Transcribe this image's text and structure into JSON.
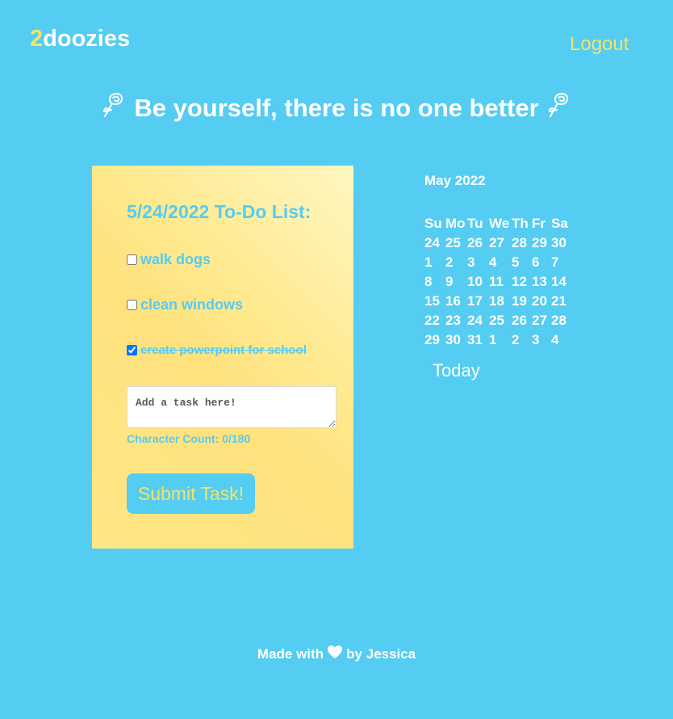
{
  "header": {
    "logo_accent": "2",
    "logo_text": "doozies",
    "logout_label": "Logout"
  },
  "quote": {
    "text": "Be yourself, there is no one better",
    "icon": "rose-icon"
  },
  "todo": {
    "title": "5/24/2022 To-Do List:",
    "tasks": [
      {
        "label": "walk dogs",
        "done": false
      },
      {
        "label": "clean windows",
        "done": false
      },
      {
        "label": "create powerpoint for school",
        "done": true
      }
    ],
    "input_placeholder": "Add a task here!",
    "input_value": "",
    "char_count": "Character Count: 0/180",
    "submit_label": "Submit Task!"
  },
  "calendar": {
    "title": "May 2022",
    "weekdays": [
      "Su",
      "Mo",
      "Tu",
      "We",
      "Th",
      "Fr",
      "Sa"
    ],
    "weeks": [
      [
        "24",
        "25",
        "26",
        "27",
        "28",
        "29",
        "30"
      ],
      [
        "1",
        "2",
        "3",
        "4",
        "5",
        "6",
        "7"
      ],
      [
        "8",
        "9",
        "10",
        "11",
        "12",
        "13",
        "14"
      ],
      [
        "15",
        "16",
        "17",
        "18",
        "19",
        "20",
        "21"
      ],
      [
        "22",
        "23",
        "24",
        "25",
        "26",
        "27",
        "28"
      ],
      [
        "29",
        "30",
        "31",
        "1",
        "2",
        "3",
        "4"
      ]
    ],
    "today_label": "Today"
  },
  "footer": {
    "prefix": "Made with",
    "suffix": "by Jessica",
    "icon": "heart-icon"
  },
  "colors": {
    "background": "#55ccf2",
    "accent_yellow": "#f2e468",
    "card_yellow": "#ffe98e",
    "text_white": "#ffffff"
  }
}
